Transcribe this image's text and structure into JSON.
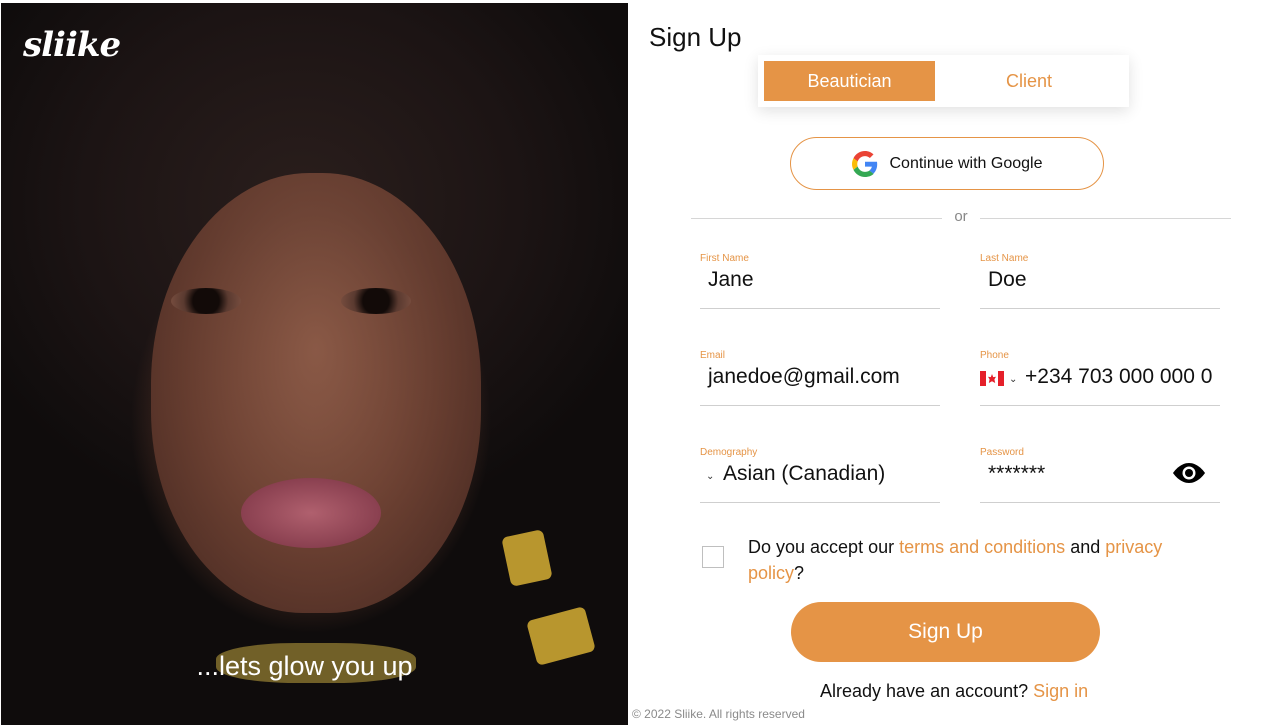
{
  "brand": {
    "logo_text": "sliike",
    "tagline": "...lets glow you up",
    "accent_color": "#e59446"
  },
  "form": {
    "title": "Sign Up",
    "roles": [
      {
        "label": "Beautician",
        "active": true
      },
      {
        "label": "Client",
        "active": false
      }
    ],
    "google_label": "Continue with Google",
    "divider_text": "or",
    "fields": {
      "first_name": {
        "label": "First Name",
        "value": "Jane"
      },
      "last_name": {
        "label": "Last Name",
        "value": "Doe"
      },
      "email": {
        "label": "Email",
        "value": "janedoe@gmail.com"
      },
      "phone": {
        "label": "Phone",
        "value": "+234 703 000 000 0",
        "country_flag": "canada-flag-icon"
      },
      "demography": {
        "label": "Demography",
        "value": "Asian (Canadian)"
      },
      "password": {
        "label": "Password",
        "value": "*******",
        "icon": "eye-icon"
      }
    },
    "terms": {
      "prefix": "Do you accept our ",
      "terms_link": "terms and conditions",
      "middle": " and ",
      "privacy_link": "privacy policy",
      "suffix": "?",
      "checked": false
    },
    "submit_label": "Sign Up",
    "have_account_text": "Already have an account? ",
    "sign_in_link": "Sign in"
  },
  "footer": {
    "copyright": "© 2022 Sliike. All rights reserved"
  }
}
